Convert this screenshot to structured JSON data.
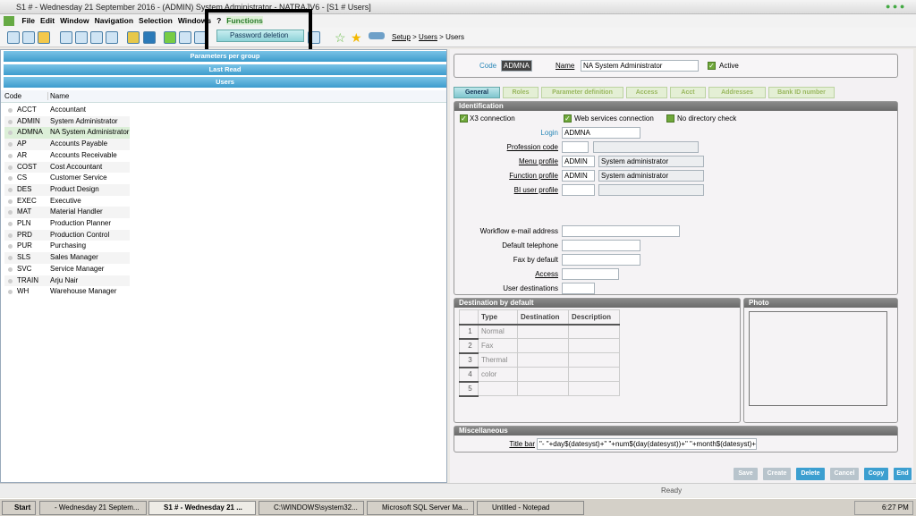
{
  "window": {
    "title": "S1 # - Wednesday 21 September 2016 - (ADMIN) System Administrator - NATRAJV6 - [S1 # Users]"
  },
  "menu": [
    "File",
    "Edit",
    "Window",
    "Navigation",
    "Selection",
    "Windows",
    "?",
    "Functions"
  ],
  "functions_menu": {
    "items": [
      "Password deletion"
    ]
  },
  "breadcrumb": [
    "Setup",
    ">",
    "Users",
    ">",
    "Users"
  ],
  "left": {
    "bands": [
      "Parameters per group",
      "Last Read",
      "Users"
    ],
    "columns": [
      "Code",
      "Name"
    ],
    "rows": [
      [
        "ACCT",
        "Accountant"
      ],
      [
        "ADMIN",
        "System Administrator"
      ],
      [
        "ADMNA",
        "NA System Administrator"
      ],
      [
        "AP",
        "Accounts Payable"
      ],
      [
        "AR",
        "Accounts Receivable"
      ],
      [
        "COST",
        "Cost Accountant"
      ],
      [
        "CS",
        "Customer Service"
      ],
      [
        "DES",
        "Product Design"
      ],
      [
        "EXEC",
        "Executive"
      ],
      [
        "MAT",
        "Material Handler"
      ],
      [
        "PLN",
        "Production Planner"
      ],
      [
        "PRD",
        "Production Control"
      ],
      [
        "PUR",
        "Purchasing"
      ],
      [
        "SLS",
        "Sales Manager"
      ],
      [
        "SVC",
        "Service Manager"
      ],
      [
        "TRAIN",
        "Arju Nair"
      ],
      [
        "WH",
        "Warehouse Manager"
      ]
    ],
    "selected": "ADMNA"
  },
  "header": {
    "code_label": "Code",
    "code": "ADMNA",
    "name_label": "Name",
    "name": "NA System Administrator",
    "active_label": "Active",
    "active": true
  },
  "tabs": [
    "General",
    "Roles",
    "Parameter definition",
    "Access",
    "Acct",
    "Addresses",
    "Bank ID number"
  ],
  "active_tab": "General",
  "identification": {
    "title": "Identification",
    "x3": "X3 connection",
    "web": "Web services connection",
    "nodir": "No directory check",
    "login_label": "Login",
    "login": "ADMNA",
    "profession_label": "Profession code",
    "menu_label": "Menu profile",
    "menu_code": "ADMIN",
    "menu_desc": "System administrator",
    "function_label": "Function profile",
    "function_code": "ADMIN",
    "function_desc": "System administrator",
    "bi_label": "BI user profile",
    "email_label": "Workflow e-mail address",
    "phone_label": "Default telephone",
    "fax_label": "Fax by default",
    "access_label": "Access",
    "dest_label": "User destinations"
  },
  "destination": {
    "title": "Destination by default",
    "columns": [
      "Type",
      "Destination",
      "Description"
    ],
    "rows": [
      [
        "1",
        "Normal"
      ],
      [
        "2",
        "Fax"
      ],
      [
        "3",
        "Thermal"
      ],
      [
        "4",
        "color"
      ],
      [
        "5",
        ""
      ]
    ]
  },
  "photo": {
    "title": "Photo"
  },
  "misc": {
    "title": "Miscellaneous",
    "titlebar_label": "Title bar",
    "titlebar": "\"- \"+day$(datesyst)+\" \"+num$(day(datesyst))+\" \"+month$(datesyst)+'"
  },
  "buttons": [
    "Save",
    "Create",
    "Delete",
    "Cancel",
    "Copy",
    "End"
  ],
  "status": "Ready",
  "taskbar": {
    "start": "Start",
    "tasks": [
      "- Wednesday 21 Septem...",
      "S1 # - Wednesday 21 ...",
      "C:\\WINDOWS\\system32...",
      "Microsoft SQL Server Ma...",
      "Untitled - Notepad"
    ],
    "clock": "6:27 PM"
  }
}
